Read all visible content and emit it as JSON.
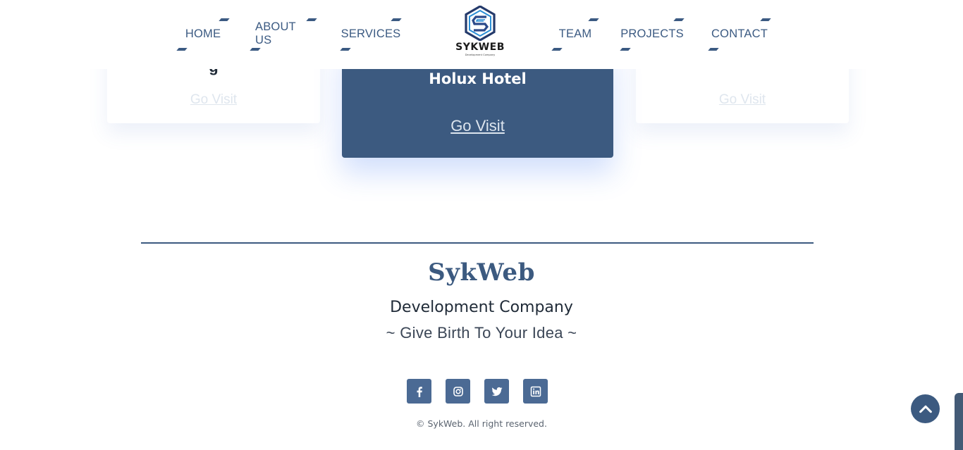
{
  "nav": {
    "items": [
      {
        "label": "HOME"
      },
      {
        "label": "ABOUT US"
      },
      {
        "label": "SERVICES"
      },
      {
        "label": "TEAM"
      },
      {
        "label": "PROJECTS"
      },
      {
        "label": "CONTACT"
      }
    ],
    "logo": {
      "name": "SYKWEB",
      "subtitle": "Development Company"
    }
  },
  "projects": {
    "left": {
      "partial_title": "g",
      "visit_label": "Go Visit"
    },
    "center": {
      "title": "Holux Hotel",
      "visit_label": "Go Visit"
    },
    "right": {
      "visit_label": "Go Visit"
    }
  },
  "footer": {
    "brand": "SykWeb",
    "subtitle": "Development Company",
    "tagline": "~ Give Birth To Your Idea ~",
    "social": [
      {
        "icon": "facebook-icon"
      },
      {
        "icon": "instagram-icon"
      },
      {
        "icon": "twitter-icon"
      },
      {
        "icon": "linkedin-icon"
      }
    ],
    "copyright": "© SykWeb. All right reserved."
  },
  "colors": {
    "primary": "#3c5a80",
    "social_bg": "#4b6a94",
    "card_link_faded": "#dfe6ee"
  }
}
